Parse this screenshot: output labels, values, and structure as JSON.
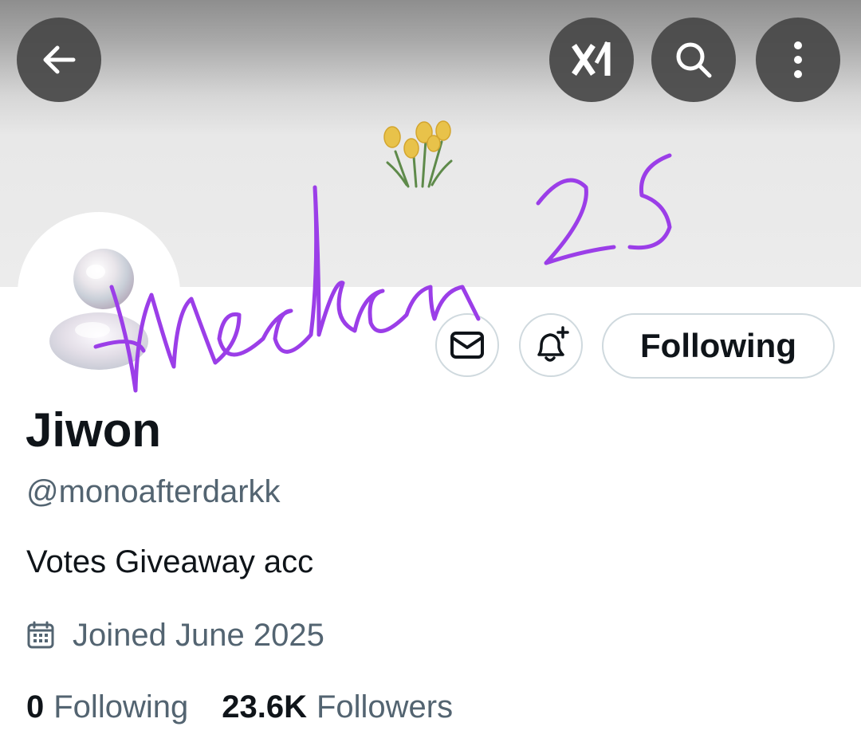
{
  "profile": {
    "display_name": "Jiwon",
    "handle": "@monoafterdarkk",
    "bio": "Votes Giveaway acc",
    "joined": "Joined June 2025",
    "following_count": "0",
    "following_label": "Following",
    "followers_count": "23.6K",
    "followers_label": "Followers"
  },
  "actions": {
    "following_button": "Following"
  },
  "icons": {
    "back": "arrow-left-icon",
    "grok": "grok-icon",
    "search": "search-icon",
    "more": "more-vertical-icon",
    "message": "envelope-icon",
    "notify": "bell-plus-icon",
    "calendar": "calendar-icon"
  },
  "colors": {
    "text_primary": "#0f1419",
    "text_secondary": "#536471",
    "border": "#cfd9de",
    "watermark": "#9b3ee8"
  }
}
